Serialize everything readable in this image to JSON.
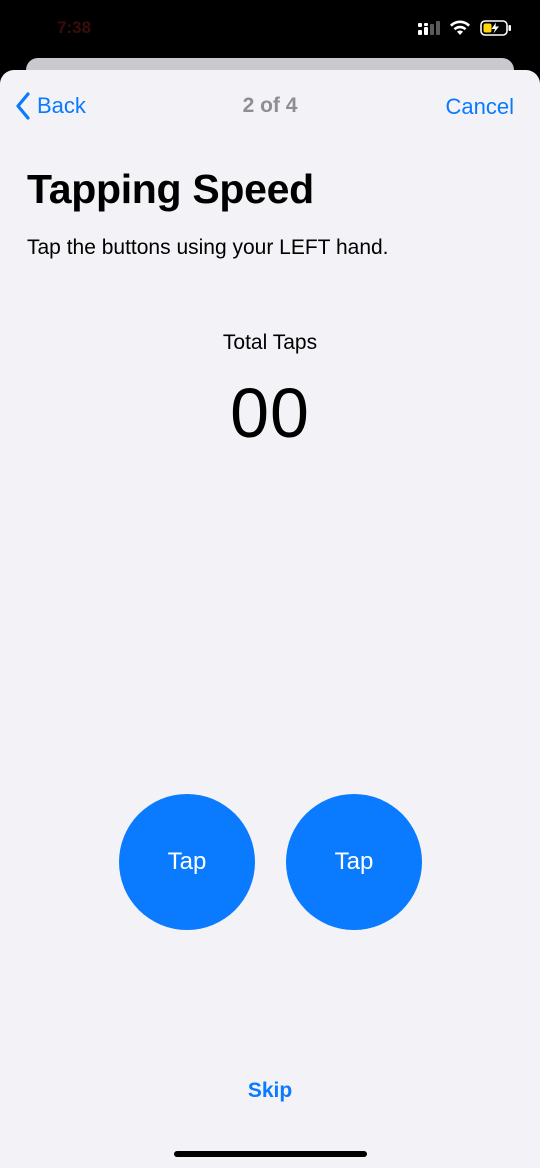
{
  "status_bar": {
    "time": "7:38",
    "icons": [
      "signal-icon",
      "wifi-icon",
      "battery-charging-icon"
    ],
    "battery_color": "#ffd60a"
  },
  "nav": {
    "back_label": "Back",
    "step": "2 of 4",
    "cancel_label": "Cancel"
  },
  "content": {
    "title": "Tapping Speed",
    "instructions": "Tap the buttons using your LEFT hand.",
    "counter_label": "Total Taps",
    "counter_value": "00"
  },
  "buttons": {
    "left_tap": "Tap",
    "right_tap": "Tap",
    "skip": "Skip"
  },
  "colors": {
    "accent": "#0a7aff",
    "background": "#f2f2f7",
    "secondary_text": "#8e8e93"
  }
}
